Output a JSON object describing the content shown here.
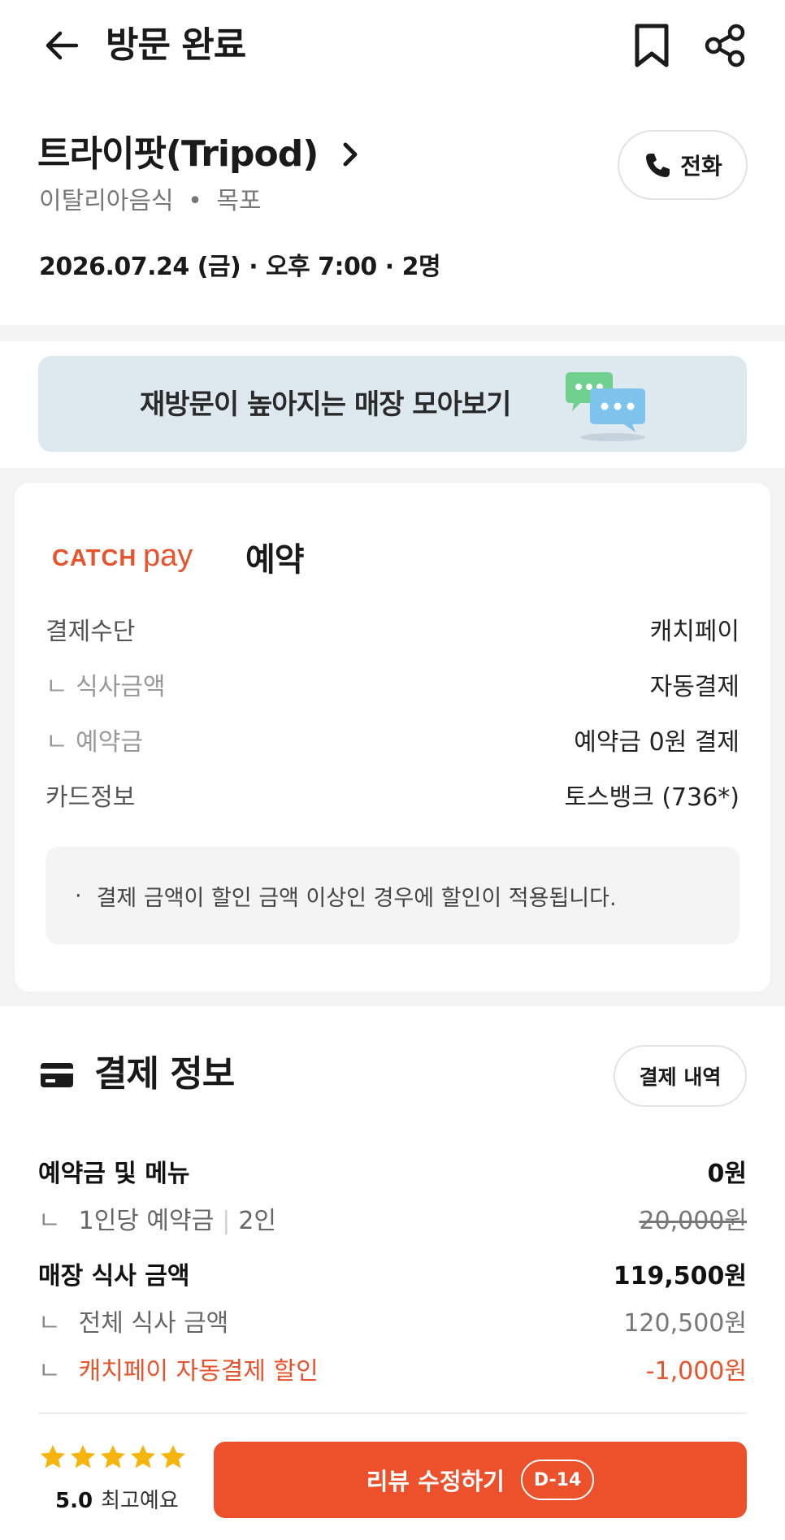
{
  "header": {
    "title": "방문 완료"
  },
  "store": {
    "name": "트라이팟(Tripod)",
    "category": "이탈리아음식",
    "location": "목포",
    "sub_separator": "•",
    "date_line": "2026.07.24 (금) · 오후 7:00 · 2명",
    "call_label": "전화"
  },
  "banner": {
    "text": "재방문이 높아지는 매장 모아보기"
  },
  "catchpay": {
    "logo_text": "CATCHpay",
    "label": "예약",
    "rows": [
      {
        "label": "결제수단",
        "value": "캐치페이"
      },
      {
        "label": "ㄴ 식사금액",
        "value": "자동결제"
      },
      {
        "label": "ㄴ 예약금",
        "value": "예약금 0원 결제"
      },
      {
        "label": "카드정보",
        "value": "토스뱅크 (736*)"
      }
    ],
    "notice_bullet": "·",
    "notice": "결제 금액이 할인 금액 이상인 경우에 할인이 적용됩니다."
  },
  "payment_info": {
    "title": "결제 정보",
    "history_label": "결제 내역",
    "deposit_label": "예약금 및 메뉴",
    "deposit_value": "0원",
    "per_person_hook": "ㄴ",
    "per_person_label": "1인당 예약금",
    "per_person_sep": "|",
    "per_person_count": "2인",
    "per_person_value": "20,000원",
    "dining_label": "매장 식사 금액",
    "dining_value": "119,500원",
    "total_hook": "ㄴ",
    "total_label": "전체 식사 금액",
    "total_value": "120,500원",
    "discount_hook": "ㄴ",
    "discount_label": "캐치페이 자동결제 할인",
    "discount_value": "-1,000원"
  },
  "bottom": {
    "stars": 5,
    "score": "5.0",
    "score_text": "최고예요",
    "review_button": "리뷰 수정하기",
    "dday": "D-14"
  },
  "colors": {
    "accent": "#ec512b",
    "star": "#f6b40e",
    "banner_bg": "#dde8ef"
  }
}
